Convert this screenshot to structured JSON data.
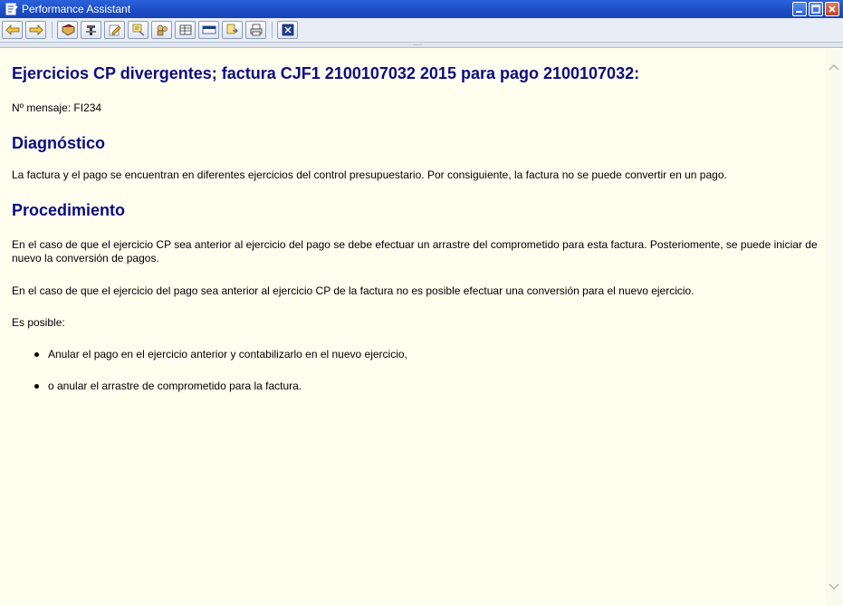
{
  "window": {
    "title": "Performance Assistant"
  },
  "toolbar": {
    "buttons": [
      {
        "name": "back-button",
        "icon": "arrow-left-icon"
      },
      {
        "name": "forward-button",
        "icon": "arrow-right-icon"
      },
      {
        "name": "glossary-button",
        "icon": "book-icon"
      },
      {
        "name": "technical-info-button",
        "icon": "tools-icon"
      },
      {
        "name": "edit-button",
        "icon": "pencil-icon"
      },
      {
        "name": "notes-button",
        "icon": "note-icon"
      },
      {
        "name": "user-settings-button",
        "icon": "people-icon"
      },
      {
        "name": "table-button",
        "icon": "table-icon"
      },
      {
        "name": "display-button",
        "icon": "display-icon"
      },
      {
        "name": "export-button",
        "icon": "export-icon"
      },
      {
        "name": "print-button",
        "icon": "printer-icon"
      },
      {
        "name": "close-doc-button",
        "icon": "close-icon"
      }
    ]
  },
  "content": {
    "title": "Ejercicios CP divergentes; factura CJF1 2100107032 2015 para pago 2100107032:",
    "message_number": "Nº mensaje: FI234",
    "diagnosis_heading": "Diagnóstico",
    "diagnosis_text": "La factura y el pago se encuentran en diferentes ejercicios del control presupuestario. Por consiguiente, la factura no se puede convertir en un pago.",
    "procedure_heading": "Procedimiento",
    "procedure_p1": "En el caso de que el ejercicio CP sea anterior al ejercicio del pago se debe efectuar un arrastre del comprometido para esta factura. Posteriomente, se puede iniciar de nuevo la conversión de pagos.",
    "procedure_p2": "En el caso de que el ejercicio del pago sea anterior al ejercicio CP de la factura no es posible efectuar una conversión para el nuevo ejercicio.",
    "procedure_p3": "Es posible:",
    "options": [
      "Anular el pago en el ejercicio anterior y contabilizarlo en el nuevo ejercicio,",
      "o anular el arrastre de comprometido para la factura."
    ]
  },
  "colors": {
    "heading": "#0c0c82",
    "background": "#fffff0",
    "titlebar": "#1c4cc4"
  }
}
